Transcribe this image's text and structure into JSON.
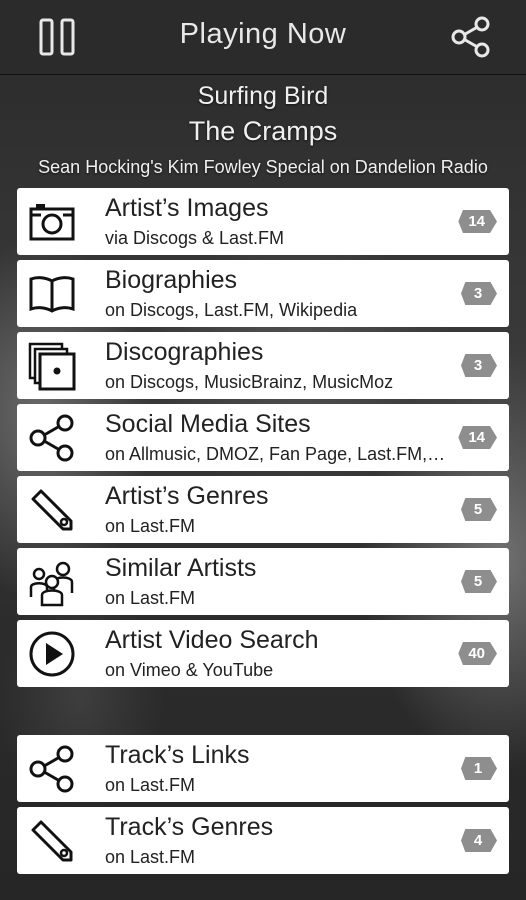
{
  "header": {
    "title": "Playing Now",
    "pause_icon": "pause-icon",
    "share_icon": "share-icon"
  },
  "track": {
    "song": "Surfing Bird",
    "artist": "The Cramps",
    "station": "Sean Hocking's Kim Fowley Special on Dandelion Radio"
  },
  "artist_items": [
    {
      "icon": "camera-icon",
      "title": "Artist’s Images",
      "subtitle": "via Discogs & Last.FM",
      "count": "14"
    },
    {
      "icon": "book-icon",
      "title": "Biographies",
      "subtitle": "on Discogs, Last.FM, Wikipedia",
      "count": "3"
    },
    {
      "icon": "records-icon",
      "title": "Discographies",
      "subtitle": "on Discogs, MusicBrainz, MusicMoz",
      "count": "3"
    },
    {
      "icon": "share-icon",
      "title": "Social Media Sites",
      "subtitle": "on Allmusic, DMOZ, Fan Page, Last.FM, MySpace",
      "count": "14"
    },
    {
      "icon": "tag-icon",
      "title": "Artist’s Genres",
      "subtitle": "on Last.FM",
      "count": "5"
    },
    {
      "icon": "people-icon",
      "title": "Similar Artists",
      "subtitle": "on Last.FM",
      "count": "5"
    },
    {
      "icon": "play-icon",
      "title": "Artist Video Search",
      "subtitle": "on Vimeo & YouTube",
      "count": "40"
    }
  ],
  "track_items": [
    {
      "icon": "share-icon",
      "title": "Track’s Links",
      "subtitle": "on Last.FM",
      "count": "1"
    },
    {
      "icon": "tag-icon",
      "title": "Track’s Genres",
      "subtitle": "on Last.FM",
      "count": "4"
    }
  ]
}
